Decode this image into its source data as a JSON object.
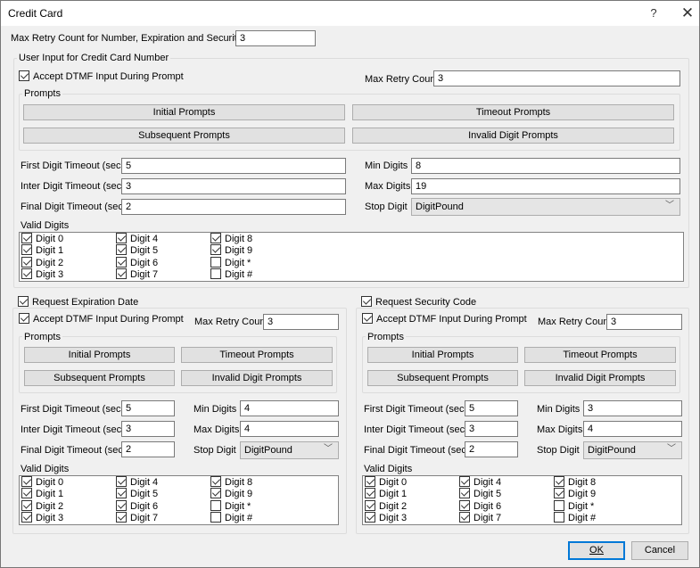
{
  "window": {
    "title": "Credit Card",
    "help_label": "?",
    "close_label": "✕"
  },
  "global": {
    "max_retry_label": "Max Retry Count for Number, Expiration and Security Code",
    "max_retry_value": "3"
  },
  "card_number": {
    "group_label": "User Input for Credit Card Number",
    "accept_dtmf_label": "Accept DTMF Input During Prompt",
    "accept_dtmf_checked": true,
    "max_retry_label": "Max Retry Count",
    "max_retry_value": "3",
    "prompts_label": "Prompts",
    "buttons": {
      "initial": "Initial Prompts",
      "timeout": "Timeout Prompts",
      "subsequent": "Subsequent Prompts",
      "invalid": "Invalid Digit Prompts"
    },
    "first_digit_label": "First Digit Timeout (secs)",
    "first_digit_value": "5",
    "inter_digit_label": "Inter Digit Timeout (secs)",
    "inter_digit_value": "3",
    "final_digit_label": "Final Digit Timeout (secs)",
    "final_digit_value": "2",
    "min_digits_label": "Min Digits",
    "min_digits_value": "8",
    "max_digits_label": "Max Digits",
    "max_digits_value": "19",
    "stop_digit_label": "Stop Digit",
    "stop_digit_value": "DigitPound",
    "valid_digits_label": "Valid Digits",
    "digits": [
      {
        "label": "Digit 0",
        "checked": true
      },
      {
        "label": "Digit 1",
        "checked": true
      },
      {
        "label": "Digit 2",
        "checked": true
      },
      {
        "label": "Digit 3",
        "checked": true
      },
      {
        "label": "Digit 4",
        "checked": true
      },
      {
        "label": "Digit 5",
        "checked": true
      },
      {
        "label": "Digit 6",
        "checked": true
      },
      {
        "label": "Digit 7",
        "checked": true
      },
      {
        "label": "Digit 8",
        "checked": true
      },
      {
        "label": "Digit 9",
        "checked": true
      },
      {
        "label": "Digit *",
        "checked": false
      },
      {
        "label": "Digit #",
        "checked": false
      }
    ]
  },
  "expiration": {
    "group_label": "Request Expiration Date",
    "group_checked": true,
    "accept_dtmf_label": "Accept DTMF Input During Prompt",
    "accept_dtmf_checked": true,
    "max_retry_label": "Max Retry Count",
    "max_retry_value": "3",
    "prompts_label": "Prompts",
    "buttons": {
      "initial": "Initial Prompts",
      "timeout": "Timeout Prompts",
      "subsequent": "Subsequent Prompts",
      "invalid": "Invalid Digit Prompts"
    },
    "first_digit_label": "First Digit Timeout (secs)",
    "first_digit_value": "5",
    "inter_digit_label": "Inter Digit Timeout (secs)",
    "inter_digit_value": "3",
    "final_digit_label": "Final Digit Timeout (secs)",
    "final_digit_value": "2",
    "min_digits_label": "Min Digits",
    "min_digits_value": "4",
    "max_digits_label": "Max Digits",
    "max_digits_value": "4",
    "stop_digit_label": "Stop Digit",
    "stop_digit_value": "DigitPound",
    "valid_digits_label": "Valid Digits",
    "digits": [
      {
        "label": "Digit 0",
        "checked": true
      },
      {
        "label": "Digit 1",
        "checked": true
      },
      {
        "label": "Digit 2",
        "checked": true
      },
      {
        "label": "Digit 3",
        "checked": true
      },
      {
        "label": "Digit 4",
        "checked": true
      },
      {
        "label": "Digit 5",
        "checked": true
      },
      {
        "label": "Digit 6",
        "checked": true
      },
      {
        "label": "Digit 7",
        "checked": true
      },
      {
        "label": "Digit 8",
        "checked": true
      },
      {
        "label": "Digit 9",
        "checked": true
      },
      {
        "label": "Digit *",
        "checked": false
      },
      {
        "label": "Digit #",
        "checked": false
      }
    ]
  },
  "security": {
    "group_label": "Request Security Code",
    "group_checked": true,
    "accept_dtmf_label": "Accept DTMF Input During Prompt",
    "accept_dtmf_checked": true,
    "max_retry_label": "Max Retry Count",
    "max_retry_value": "3",
    "prompts_label": "Prompts",
    "buttons": {
      "initial": "Initial Prompts",
      "timeout": "Timeout Prompts",
      "subsequent": "Subsequent Prompts",
      "invalid": "Invalid Digit Prompts"
    },
    "first_digit_label": "First Digit Timeout (secs)",
    "first_digit_value": "5",
    "inter_digit_label": "Inter Digit Timeout (secs)",
    "inter_digit_value": "3",
    "final_digit_label": "Final Digit Timeout (secs)",
    "final_digit_value": "2",
    "min_digits_label": "Min Digits",
    "min_digits_value": "3",
    "max_digits_label": "Max Digits",
    "max_digits_value": "4",
    "stop_digit_label": "Stop Digit",
    "stop_digit_value": "DigitPound",
    "valid_digits_label": "Valid Digits",
    "digits": [
      {
        "label": "Digit 0",
        "checked": true
      },
      {
        "label": "Digit 1",
        "checked": true
      },
      {
        "label": "Digit 2",
        "checked": true
      },
      {
        "label": "Digit 3",
        "checked": true
      },
      {
        "label": "Digit 4",
        "checked": true
      },
      {
        "label": "Digit 5",
        "checked": true
      },
      {
        "label": "Digit 6",
        "checked": true
      },
      {
        "label": "Digit 7",
        "checked": true
      },
      {
        "label": "Digit 8",
        "checked": true
      },
      {
        "label": "Digit 9",
        "checked": true
      },
      {
        "label": "Digit *",
        "checked": false
      },
      {
        "label": "Digit #",
        "checked": false
      }
    ]
  },
  "footer": {
    "ok_label": "OK",
    "cancel_label": "Cancel"
  }
}
